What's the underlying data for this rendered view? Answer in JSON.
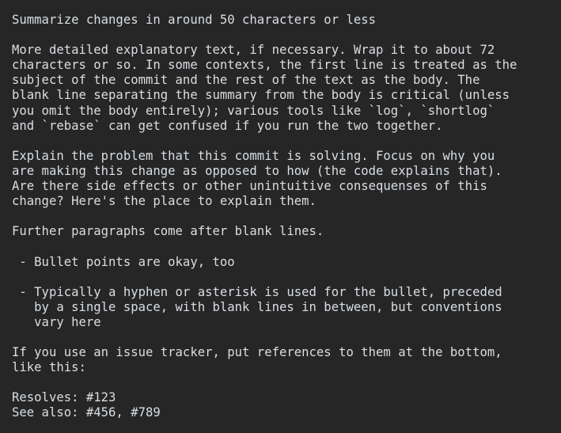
{
  "commit_message": {
    "lines": [
      "Summarize changes in around 50 characters or less",
      "",
      "More detailed explanatory text, if necessary. Wrap it to about 72",
      "characters or so. In some contexts, the first line is treated as the",
      "subject of the commit and the rest of the text as the body. The",
      "blank line separating the summary from the body is critical (unless",
      "you omit the body entirely); various tools like `log`, `shortlog`",
      "and `rebase` can get confused if you run the two together.",
      "",
      "Explain the problem that this commit is solving. Focus on why you",
      "are making this change as opposed to how (the code explains that).",
      "Are there side effects or other unintuitive consequenses of this",
      "change? Here's the place to explain them.",
      "",
      "Further paragraphs come after blank lines.",
      "",
      " - Bullet points are okay, too",
      "",
      " - Typically a hyphen or asterisk is used for the bullet, preceded",
      "   by a single space, with blank lines in between, but conventions",
      "   vary here",
      "",
      "If you use an issue tracker, put references to them at the bottom,",
      "like this:",
      "",
      "Resolves: #123",
      "See also: #456, #789"
    ]
  },
  "colors": {
    "background": "#262626",
    "text": "#d9dee3"
  }
}
